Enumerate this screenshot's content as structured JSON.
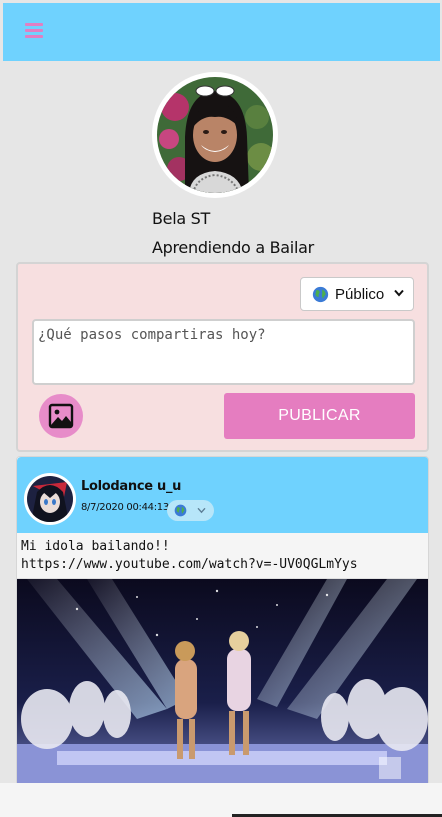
{
  "header": {
    "menu_icon": "hamburger-menu-icon",
    "background_color": "#6fd2fe",
    "accent_color": "#e17fc2"
  },
  "profile": {
    "name": "Bela ST",
    "status": "Aprendiendo a Bailar",
    "avatar_icon": "user-avatar"
  },
  "composer": {
    "privacy_label": "Público",
    "privacy_icon": "globe-icon",
    "input_placeholder": "¿Qué pasos compartiras hoy?",
    "input_value": "",
    "image_icon": "image-icon",
    "publish_label": "PUBLICAR",
    "background_color": "#f7dfe0",
    "button_color": "#e57dc0"
  },
  "post": {
    "author": "Lolodance u_u",
    "date": "8/7/2020 00:44:13",
    "privacy_icon": "globe-icon",
    "text": "Mi idola bailando!!\nhttps://www.youtube.com/watch?v=-UV0QGLmYys",
    "media_icon": "video-thumbnail"
  }
}
